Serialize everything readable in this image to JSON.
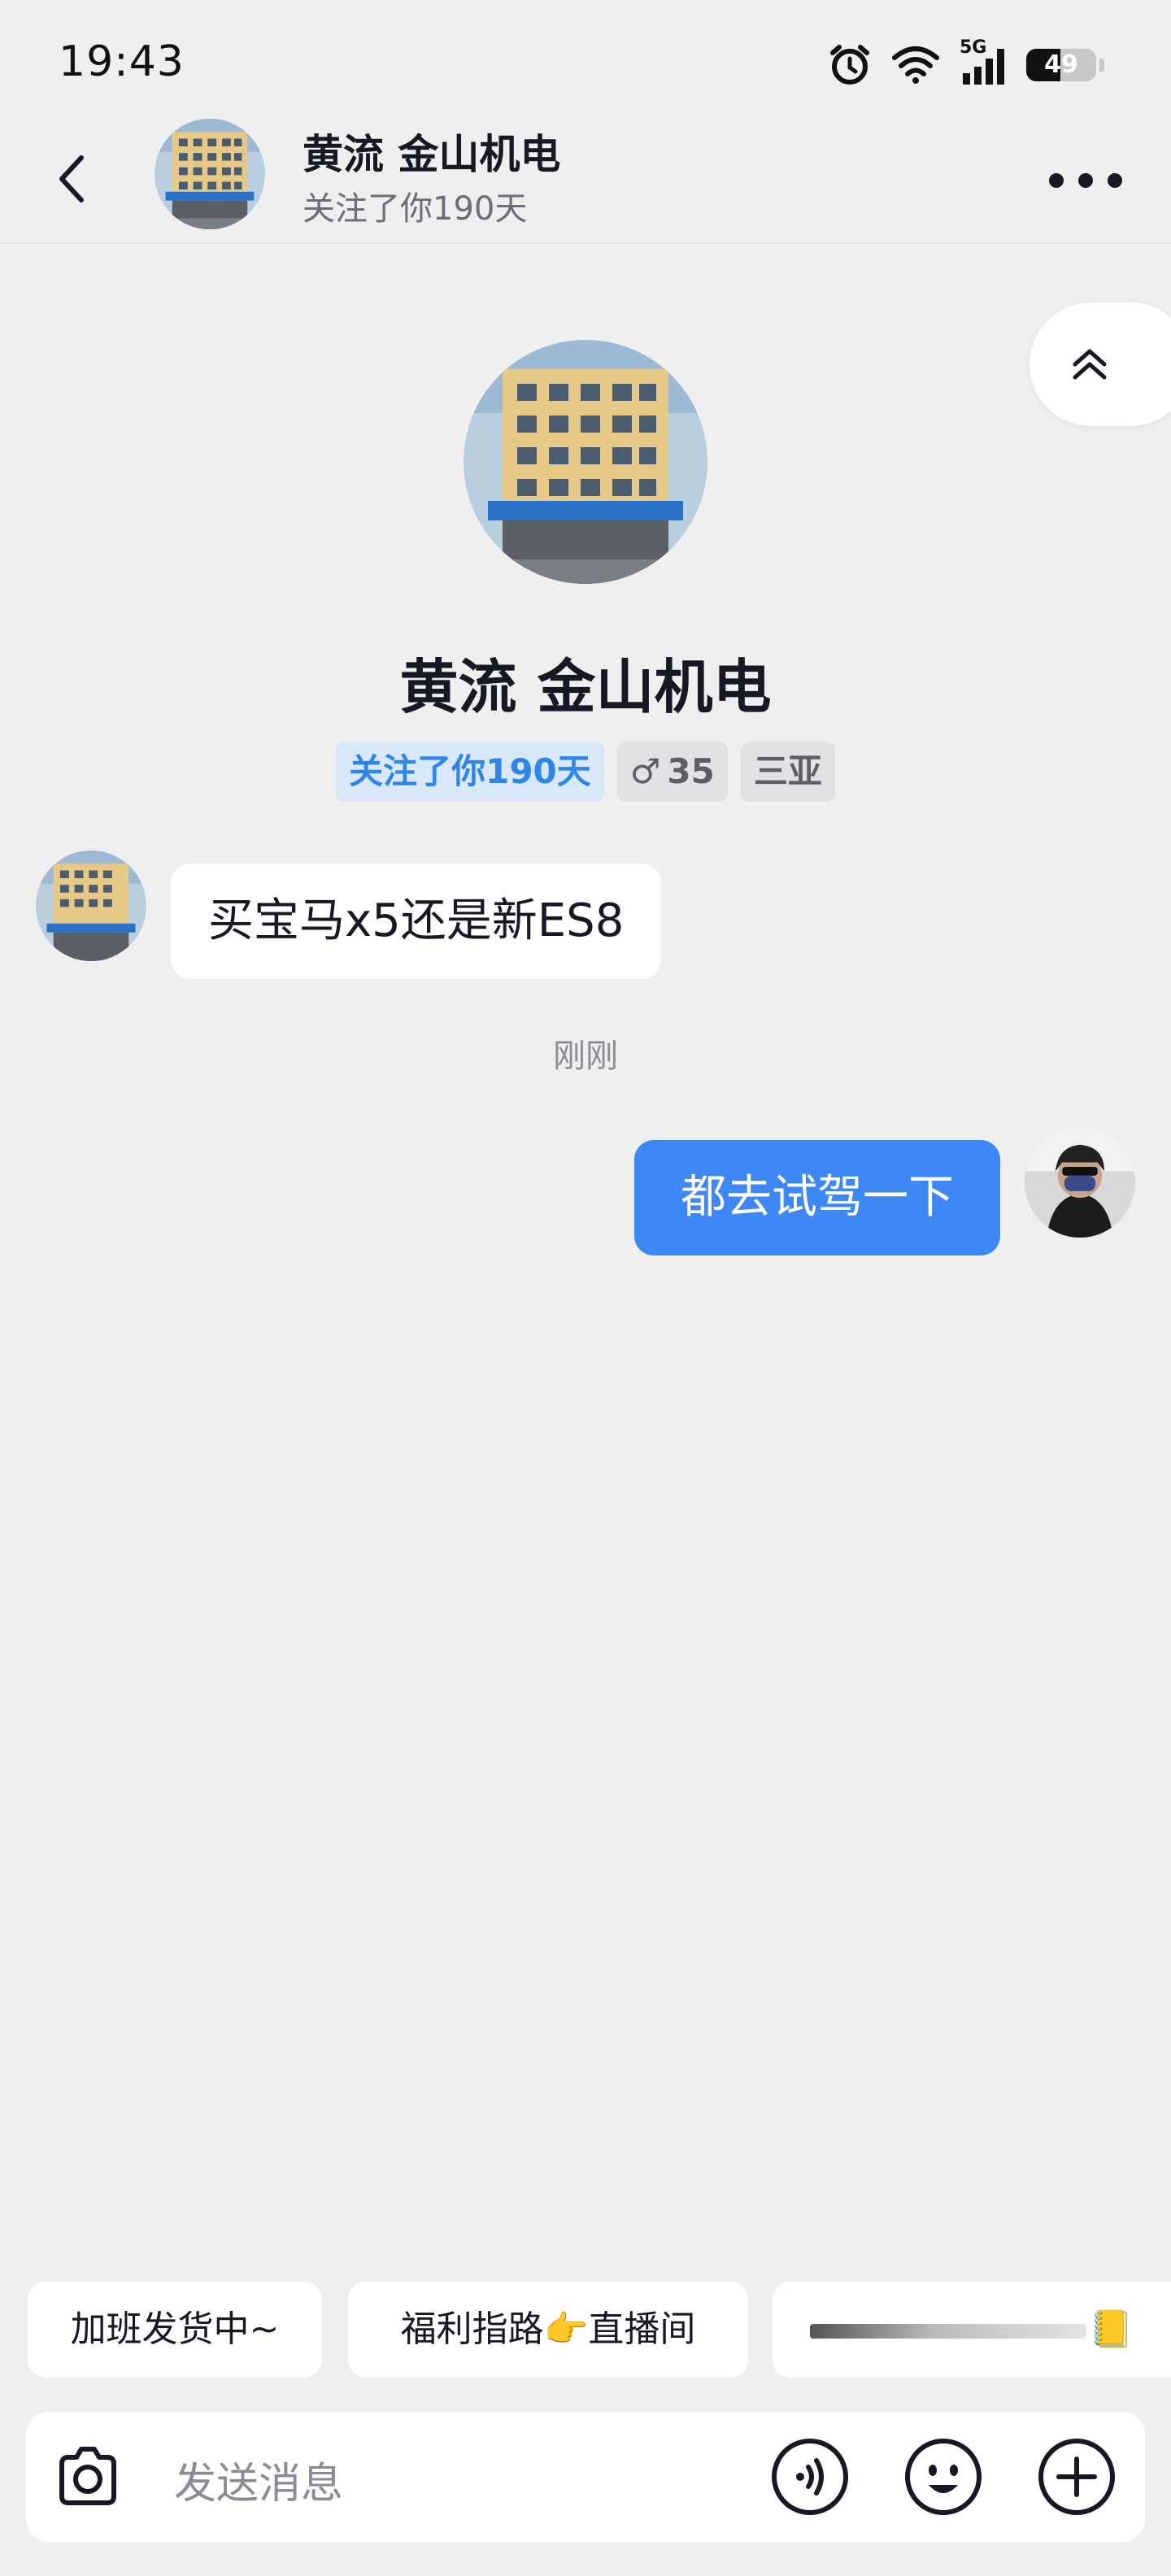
{
  "status_bar": {
    "time": "19:43",
    "battery_level": "49",
    "network_label": "5G",
    "icons": [
      "alarm-icon",
      "wifi-icon",
      "signal-icon",
      "battery-icon"
    ]
  },
  "header": {
    "name": "黄流 金山机电",
    "subtitle": "关注了你190天",
    "icons": [
      "back-arrow-icon",
      "more-icon"
    ]
  },
  "profile": {
    "name": "黄流 金山机电",
    "tags": {
      "follow": "关注了你190天",
      "gender_symbol": "♂",
      "age": "35",
      "city": "三亚"
    }
  },
  "messages": {
    "incoming_text": "买宝马x5还是新ES8",
    "timestamp": "刚刚",
    "outgoing_text": "都去试驾一下"
  },
  "quick_replies": {
    "item1": "加班发货中~",
    "item2": "福利指路👉直播间",
    "item3_emoji": "📒"
  },
  "input_bar": {
    "placeholder": "发送消息",
    "icons": [
      "camera-icon",
      "voice-icon",
      "emoji-icon",
      "plus-icon"
    ]
  },
  "colors": {
    "background": "#efefef",
    "accent_blue": "#3d88f5",
    "tag_blue_text": "#2f86e8",
    "tag_blue_bg": "#d8e8f8"
  }
}
